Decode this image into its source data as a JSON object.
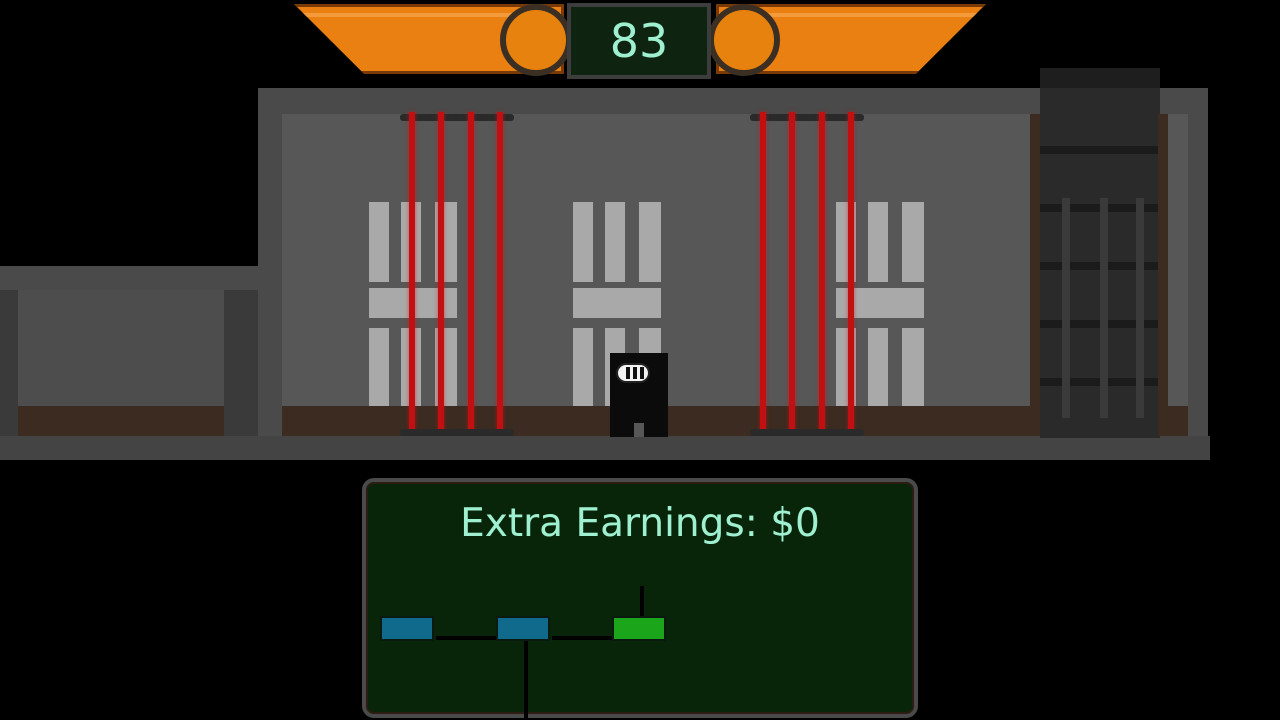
{
  "hud": {
    "timer_value": "83",
    "accent_color": "#ea7f12",
    "display_color": "#0e2410",
    "text_color": "#9ff0d0"
  },
  "level": {
    "laser_color": "#c10f12",
    "laser_groups": 2,
    "lasers_per_group": 4
  },
  "player": {
    "icon": "masked-thief-icon",
    "color": "#0b0b0b"
  },
  "earnings_panel": {
    "label": "Extra Earnings: $0",
    "nodes": [
      {
        "name": "node-1",
        "state": "locked",
        "color": "#0f6a8c"
      },
      {
        "name": "node-2",
        "state": "locked",
        "color": "#0f6a8c"
      },
      {
        "name": "node-3",
        "state": "active",
        "color": "#1aa51a"
      }
    ]
  }
}
